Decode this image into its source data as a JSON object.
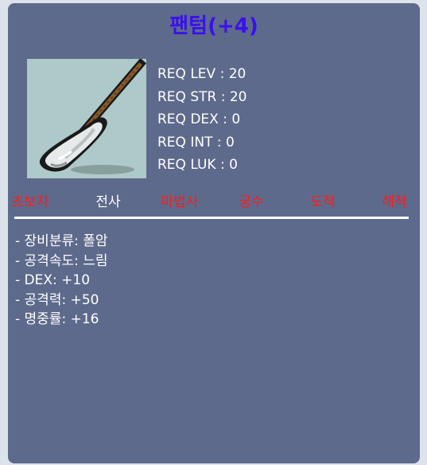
{
  "item": {
    "name": "팬텀(+4)",
    "icon": "pole-arm-weapon-icon"
  },
  "requirements": [
    "REQ LEV : 20",
    "REQ STR : 20",
    "REQ DEX : 0",
    "REQ INT : 0",
    "REQ LUK : 0"
  ],
  "jobs": [
    {
      "label": "초보자",
      "available": false
    },
    {
      "label": "전사",
      "available": true
    },
    {
      "label": "마법사",
      "available": false
    },
    {
      "label": "궁수",
      "available": false
    },
    {
      "label": "도적",
      "available": false
    },
    {
      "label": "해적",
      "available": false
    }
  ],
  "stats": [
    "- 장비분류: 폴암",
    "- 공격속도: 느림",
    "- DEX: +10",
    "- 공격력: +50",
    "- 명중률: +16"
  ],
  "colors": {
    "title": "#3a10ee",
    "job_available": "#ffffff",
    "job_unavailable": "#ff1a1a",
    "panel": "#5e6a8b"
  }
}
